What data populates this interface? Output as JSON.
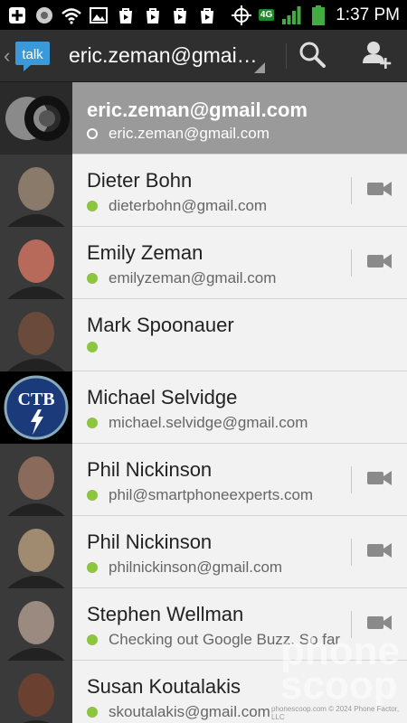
{
  "status_bar": {
    "time": "1:37 PM",
    "network_type": "4G",
    "icons": [
      "plus-icon",
      "sync-icon",
      "wifi-icon",
      "image-icon",
      "play-store-icon",
      "play-store-icon",
      "play-store-icon",
      "play-store-icon",
      "gps-icon",
      "signal-icon",
      "battery-icon"
    ]
  },
  "action_bar": {
    "app_logo_text": "talk",
    "account": "eric.zeman@gmai…",
    "search_icon": "search-icon",
    "add_friend_icon": "add-person-icon"
  },
  "self": {
    "name": "eric.zeman@gmail.com",
    "status": "eric.zeman@gmail.com",
    "presence": "offline"
  },
  "contacts": [
    {
      "name": "Dieter Bohn",
      "status": "dieterbohn@gmail.com",
      "video": true,
      "avatar_color": "#8a7a6a"
    },
    {
      "name": "Emily Zeman",
      "status": "emilyzeman@gmail.com",
      "video": true,
      "avatar_color": "#b86a5a"
    },
    {
      "name": "Mark Spoonauer",
      "status": "",
      "video": false,
      "avatar_color": "#6a4a3a"
    },
    {
      "name": "Michael Selvidge",
      "status": "michael.selvidge@gmail.com",
      "video": false,
      "avatar_color": "#1a3a7a"
    },
    {
      "name": "Phil Nickinson",
      "status": "phil@smartphoneexperts.com",
      "video": true,
      "avatar_color": "#8a6a5a"
    },
    {
      "name": "Phil Nickinson",
      "status": "philnickinson@gmail.com",
      "video": true,
      "avatar_color": "#a08a70"
    },
    {
      "name": "Stephen Wellman",
      "status": "Checking out Google Buzz. So far",
      "video": true,
      "avatar_color": "#9a8a80"
    },
    {
      "name": "Susan Koutalakis",
      "status": "skoutalakis@gmail.com",
      "video": false,
      "avatar_color": "#6a4030"
    }
  ],
  "avatar_monogram": "CTB",
  "watermark": {
    "line1": "phone",
    "line2": "scoop"
  },
  "footer": "phonescoop.com  © 2024 Phone Factor, LLC",
  "colors": {
    "online": "#8cc63f",
    "action_bar": "#2f2f2f",
    "self_row": "#9a9a9a"
  }
}
